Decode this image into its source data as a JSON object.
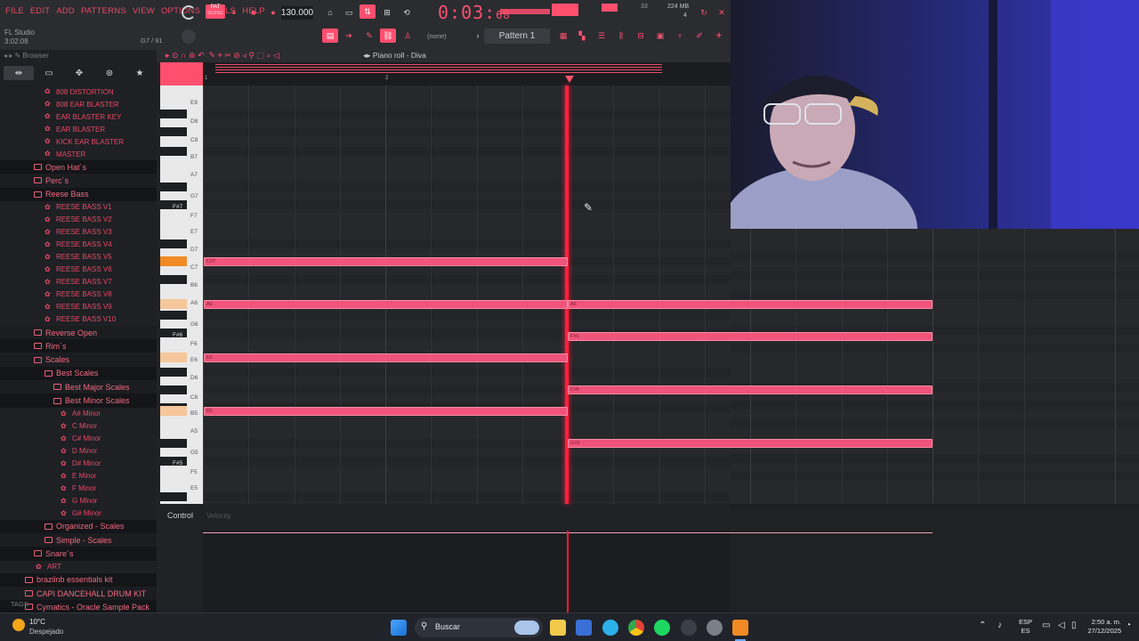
{
  "menu": [
    "FILE",
    "EDIT",
    "ADD",
    "PATTERNS",
    "VIEW",
    "OPTIONS",
    "TOOLS",
    "HELP"
  ],
  "app_name": "FL Studio",
  "song_time": "3:02:08",
  "hint_right": "G7 / 91",
  "tempo": "130.000",
  "time_display": {
    "main": "0:03:",
    "sub": "68"
  },
  "perf_mem": "224 MB",
  "perf_cpu": "4",
  "perf_sub": "33",
  "pattern": "Pattern 1",
  "none_label": "(none)",
  "transport_mode": "PAT",
  "transport_song": "SONG",
  "browser": {
    "title": "Browser",
    "footer": "TAGS",
    "rows": [
      {
        "type": "i",
        "text": "808 DISTORTION"
      },
      {
        "type": "i",
        "text": "808 EAR BLASTER"
      },
      {
        "type": "i",
        "text": "EAR BLASTER KEY"
      },
      {
        "type": "i",
        "text": "EAR BLASTER"
      },
      {
        "type": "i",
        "text": "KICK EAR BLASTER"
      },
      {
        "type": "i",
        "text": "MASTER"
      },
      {
        "type": "f",
        "text": "Open Hat´s"
      },
      {
        "type": "f",
        "text": "Perc´s"
      },
      {
        "type": "f",
        "text": "Reese Bass"
      },
      {
        "type": "i",
        "text": "REESE BASS V1"
      },
      {
        "type": "i",
        "text": "REESE BASS V2"
      },
      {
        "type": "i",
        "text": "REESE BASS V3"
      },
      {
        "type": "i",
        "text": "REESE BASS V4"
      },
      {
        "type": "i",
        "text": "REESE BASS V5"
      },
      {
        "type": "i",
        "text": "REESE BASS V6"
      },
      {
        "type": "i",
        "text": "REESE BASS V7"
      },
      {
        "type": "i",
        "text": "REESE BASS V8"
      },
      {
        "type": "i",
        "text": "REESE BASS V9"
      },
      {
        "type": "i",
        "text": "REESE BASS V10"
      },
      {
        "type": "f",
        "text": "Reverse Open"
      },
      {
        "type": "f",
        "text": "Rim´s"
      },
      {
        "type": "f",
        "text": "Scales"
      },
      {
        "type": "f",
        "text": "Best Scales"
      },
      {
        "type": "f",
        "text": "Best Major Scales"
      },
      {
        "type": "f",
        "text": "Best Minor Scales"
      },
      {
        "type": "i",
        "text": "A# Minor"
      },
      {
        "type": "i",
        "text": "C Minor"
      },
      {
        "type": "i",
        "text": "C# Minor"
      },
      {
        "type": "i",
        "text": "D Minor"
      },
      {
        "type": "i",
        "text": "D# Minor"
      },
      {
        "type": "i",
        "text": "E Minor"
      },
      {
        "type": "i",
        "text": "F Minor"
      },
      {
        "type": "i",
        "text": "G Minor"
      },
      {
        "type": "i",
        "text": "G# Minor"
      },
      {
        "type": "f",
        "text": "Organized - Scales"
      },
      {
        "type": "f",
        "text": "Simple - Scales"
      },
      {
        "type": "f",
        "text": "Snare´s"
      },
      {
        "type": "i",
        "text": "ART"
      },
      {
        "type": "f",
        "text": "brazilnb essentials kit"
      },
      {
        "type": "f",
        "text": "CAPI DANCEHALL DRUM KIT"
      },
      {
        "type": "f",
        "text": "Cymatics - Oracle Sample Pack"
      }
    ]
  },
  "piano_roll": {
    "title": "Piano roll - Diva",
    "ctrl_label": "Control",
    "ctrl_param": "Velocity",
    "bars": [
      "1",
      "2"
    ],
    "keys": [
      {
        "label": "E8"
      },
      {
        "label": "D8"
      },
      {
        "label": "C8"
      },
      {
        "label": "B7"
      },
      {
        "label": "A7"
      },
      {
        "label": "G7"
      },
      {
        "label": "F#7"
      },
      {
        "label": "F7"
      },
      {
        "label": "E7"
      },
      {
        "label": "D7"
      },
      {
        "label": "C7"
      },
      {
        "label": "B6"
      },
      {
        "label": "A6"
      },
      {
        "label": "G6"
      },
      {
        "label": "F#6"
      },
      {
        "label": "F6"
      },
      {
        "label": "E6"
      },
      {
        "label": "D6"
      },
      {
        "label": "C6"
      },
      {
        "label": "B5"
      },
      {
        "label": "A5"
      },
      {
        "label": "G5"
      },
      {
        "label": "F#5"
      },
      {
        "label": "F5"
      },
      {
        "label": "E5"
      }
    ],
    "notes": [
      {
        "label": "C#7"
      },
      {
        "label": "A6"
      },
      {
        "label": "E6"
      },
      {
        "label": "B5"
      },
      {
        "label": "A6"
      },
      {
        "label": "F#6"
      },
      {
        "label": "C#6"
      },
      {
        "label": "G#5"
      }
    ]
  },
  "taskbar": {
    "weather_temp": "10°C",
    "weather_desc": "Despejado",
    "search": "Buscar",
    "lang": "ESP",
    "lang_sub": "ES",
    "clock_time": "2:50 a. m.",
    "clock_date": "27/12/2025"
  },
  "colors": {
    "accent": "#ff4f6e",
    "note": "#f0547a",
    "playhead": "#ff1e3c"
  }
}
